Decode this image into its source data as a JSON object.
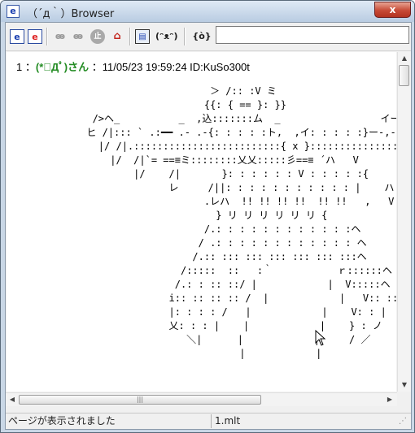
{
  "window": {
    "app_icon": "e",
    "title": "（´д｀）Browser",
    "close_label": "x"
  },
  "toolbar": {
    "icons": [
      "back-thread-icon",
      "reload-icon",
      "nav-back-icon",
      "nav-forward-icon",
      "stop-icon",
      "home-icon",
      "thread-list-icon",
      "favorites-cat-icon",
      "settings-cat-icon"
    ],
    "glyphs": {
      "back_thread": "e",
      "reload": "e",
      "nav_back": "ꙭ",
      "nav_forward": "ꙭ",
      "stop": "止",
      "home": "⌂",
      "thread_list": "▤",
      "favorites": "(ᵔᴥᵔ)",
      "settings": "{ò}"
    },
    "address_value": ""
  },
  "post": {
    "number": "1",
    "separator": " ：",
    "name": "(*ﾟДﾟ)さん",
    "date_id": " ：11/05/23 19:59:24 ID:KuSo300t"
  },
  "ascii_art": "                           ＞ /:: :V ミ\n                          {{: { == }: }}\n       />ヘ_          _  ,込:::::::ム  _                 イーミ\n      ヒ /|::: ` .:━━ .- .-{: : : : :ト,  ,イ: : : : :}ー-,-.-ー  .: ´ {_ハ}\n        |/ /|.:::::::::::::::::::::::::{ x }:::::::::::::::::::::::   ハ V\n          |/  /|`= ==≡ミ::::::::乂乂:::::彡==≡ ´ハ   V\n              |/    /|       }: : : : : : V : : : : :{        ハ    V\n                    レ     /||: : : : : : : : : : : |    ハ    V\n                          .レハ  !! !! !! !!  !! !!   ,   V\n                            } リ リ リ リ リ リ {\n                          /.: : : : : : : : : : : :ヘ\n                         / .: : : : : : : : : : : : ヘ\n                        /.:: ::: ::: ::: ::: ::: :::ヘ\n                      /:::::  ::   :｀           ｒ::::::ヘ\n                     /.: : :: ::/ |            |  V:::::ヘ\n                    i:: :: :: :: /  |            |   V:: ::i\n                    |: : : : /   |            |    V: : |\n                    乂: : : |    |            |    } : ノ\n                       ＼|      |            |     / ／\n                                |            |",
  "scroll": {
    "up": "▲",
    "down": "▼",
    "left": "◀",
    "right": "▶",
    "thumb_grip": "|||"
  },
  "status": {
    "message": "ページが表示されました",
    "file": "1.mlt",
    "grip": "⋰"
  }
}
